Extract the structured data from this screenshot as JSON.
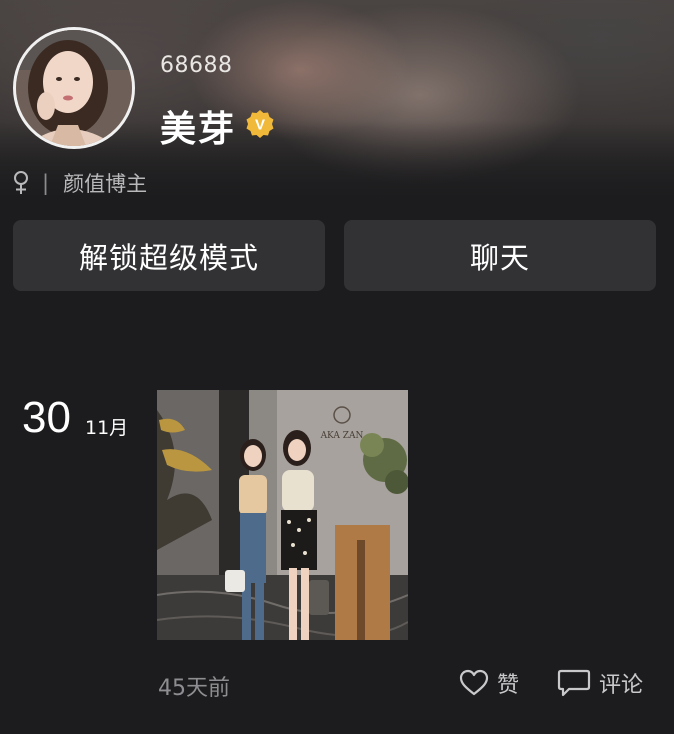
{
  "profile": {
    "user_id": "68688",
    "name": "美芽",
    "verified_badge_text": "V",
    "gender_symbol": "♀",
    "separator": "|",
    "tag": "颜值博主"
  },
  "actions": {
    "unlock_label": "解锁超级模式",
    "chat_label": "聊天"
  },
  "post": {
    "date_day": "30",
    "date_month": "11月",
    "time_ago": "45天前",
    "image_sign_text": "AKA ZAN",
    "like_label": "赞",
    "comment_label": "评论"
  },
  "icons": {
    "gender": "female-icon",
    "verified": "verified-badge-icon",
    "like": "heart-icon",
    "comment": "comment-icon"
  },
  "colors": {
    "background": "#1c1c1e",
    "button_bg": "#323235",
    "badge_gold": "#f0b93a",
    "muted_text": "#8e8e92"
  }
}
